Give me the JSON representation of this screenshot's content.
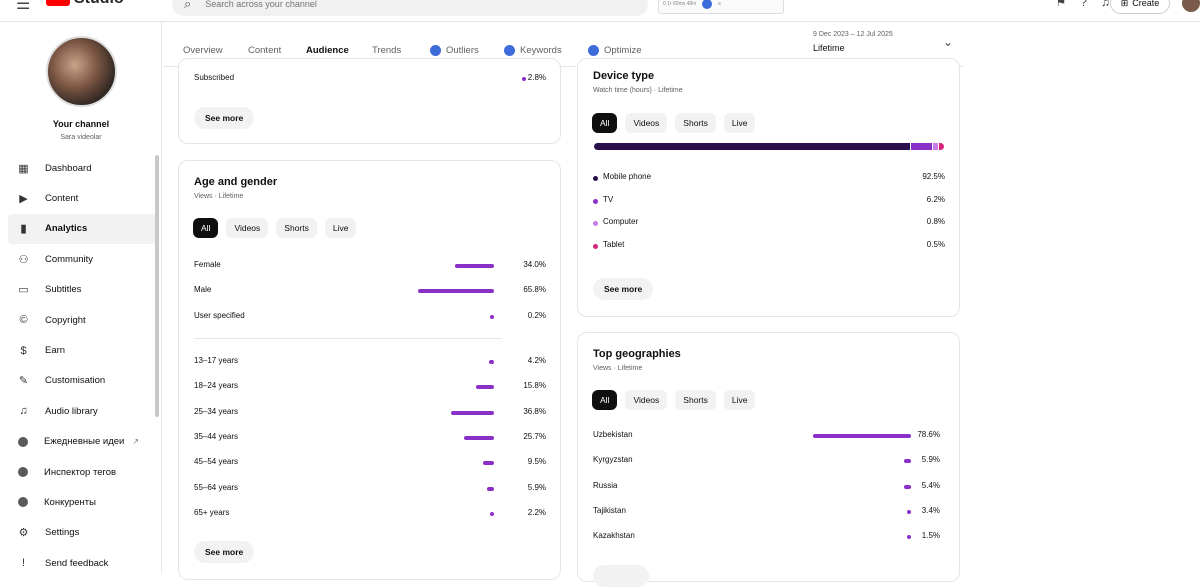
{
  "topbar": {
    "logo_text": "Studio",
    "search_placeholder": "Search across your channel",
    "extension_text": "0 1r  60ms   48ni",
    "create_label": "Create"
  },
  "sidebar": {
    "channel_title": "Your channel",
    "channel_name": "Sara videolar",
    "items": [
      {
        "label": "Dashboard",
        "icon": "dashboard-icon",
        "glyph": "▦"
      },
      {
        "label": "Content",
        "icon": "content-icon",
        "glyph": "▶"
      },
      {
        "label": "Analytics",
        "icon": "analytics-icon",
        "glyph": "▮"
      },
      {
        "label": "Community",
        "icon": "community-icon",
        "glyph": "⚇"
      },
      {
        "label": "Subtitles",
        "icon": "subtitles-icon",
        "glyph": "▭"
      },
      {
        "label": "Copyright",
        "icon": "copyright-icon",
        "glyph": "©"
      },
      {
        "label": "Earn",
        "icon": "earn-icon",
        "glyph": "$"
      },
      {
        "label": "Customisation",
        "icon": "customisation-icon",
        "glyph": "✎"
      },
      {
        "label": "Audio library",
        "icon": "audio-library-icon",
        "glyph": "♫"
      },
      {
        "label": "Ежедневные идеи",
        "icon": "ideas-extension-icon",
        "glyph": ""
      },
      {
        "label": "Инспектор тегов",
        "icon": "tag-inspector-icon",
        "glyph": ""
      },
      {
        "label": "Конкуренты",
        "icon": "competitors-icon",
        "glyph": ""
      },
      {
        "label": "Settings",
        "icon": "settings-icon",
        "glyph": "⚙"
      },
      {
        "label": "Send feedback",
        "icon": "feedback-icon",
        "glyph": "!"
      }
    ],
    "external_link_glyph": "↗"
  },
  "tabs": [
    "Overview",
    "Content",
    "Audience",
    "Trends",
    "Outliers",
    "Keywords",
    "Optimize"
  ],
  "date_range": "9 Dec 2023 – 12 Jul 2025",
  "period": "Lifetime",
  "subscribed_card": {
    "row_label": "Subscribed",
    "row_value": "2.8%",
    "see_more": "See more"
  },
  "age_gender": {
    "title": "Age and gender",
    "subtitle": "Views · Lifetime",
    "chips": [
      "All",
      "Videos",
      "Shorts",
      "Live"
    ],
    "gender": [
      {
        "label": "Female",
        "value": "34.0%",
        "pct": 34.0
      },
      {
        "label": "Male",
        "value": "65.8%",
        "pct": 65.8
      },
      {
        "label": "User specified",
        "value": "0.2%",
        "pct": 0.2
      }
    ],
    "ages": [
      {
        "label": "13–17 years",
        "value": "4.2%",
        "pct": 4.2
      },
      {
        "label": "18–24 years",
        "value": "15.8%",
        "pct": 15.8
      },
      {
        "label": "25–34 years",
        "value": "36.8%",
        "pct": 36.8
      },
      {
        "label": "35–44 years",
        "value": "25.7%",
        "pct": 25.7
      },
      {
        "label": "45–54 years",
        "value": "9.5%",
        "pct": 9.5
      },
      {
        "label": "55–64 years",
        "value": "5.9%",
        "pct": 5.9
      },
      {
        "label": "65+ years",
        "value": "2.2%",
        "pct": 2.2
      }
    ],
    "see_more": "See more"
  },
  "device_type": {
    "title": "Device type",
    "subtitle": "Watch time (hours) · Lifetime",
    "chips": [
      "All",
      "Videos",
      "Shorts",
      "Live"
    ],
    "rows": [
      {
        "label": "Mobile phone",
        "value": "92.5%",
        "pct": 92.5,
        "color": "#2b0f4a"
      },
      {
        "label": "TV",
        "value": "6.2%",
        "pct": 6.2,
        "color": "#8b2fc9"
      },
      {
        "label": "Computer",
        "value": "0.8%",
        "pct": 0.8,
        "color": "#c77de8"
      },
      {
        "label": "Tablet",
        "value": "0.5%",
        "pct": 0.5,
        "color": "#d6247a"
      }
    ],
    "see_more": "See more"
  },
  "top_geographies": {
    "title": "Top geographies",
    "subtitle": "Views · Lifetime",
    "chips": [
      "All",
      "Videos",
      "Shorts",
      "Live"
    ],
    "rows": [
      {
        "label": "Uzbekistan",
        "value": "78.6%",
        "pct": 78.6
      },
      {
        "label": "Kyrgyzstan",
        "value": "5.9%",
        "pct": 5.9
      },
      {
        "label": "Russia",
        "value": "5.4%",
        "pct": 5.4
      },
      {
        "label": "Tajikistan",
        "value": "3.4%",
        "pct": 3.4
      },
      {
        "label": "Kazakhstan",
        "value": "1.5%",
        "pct": 1.5
      }
    ]
  },
  "colors": {
    "bar": "#8b2fc9",
    "active_chip": "#0f0f0f",
    "brand_red": "#ff0000",
    "tab_dot": "#3d6bd9"
  }
}
